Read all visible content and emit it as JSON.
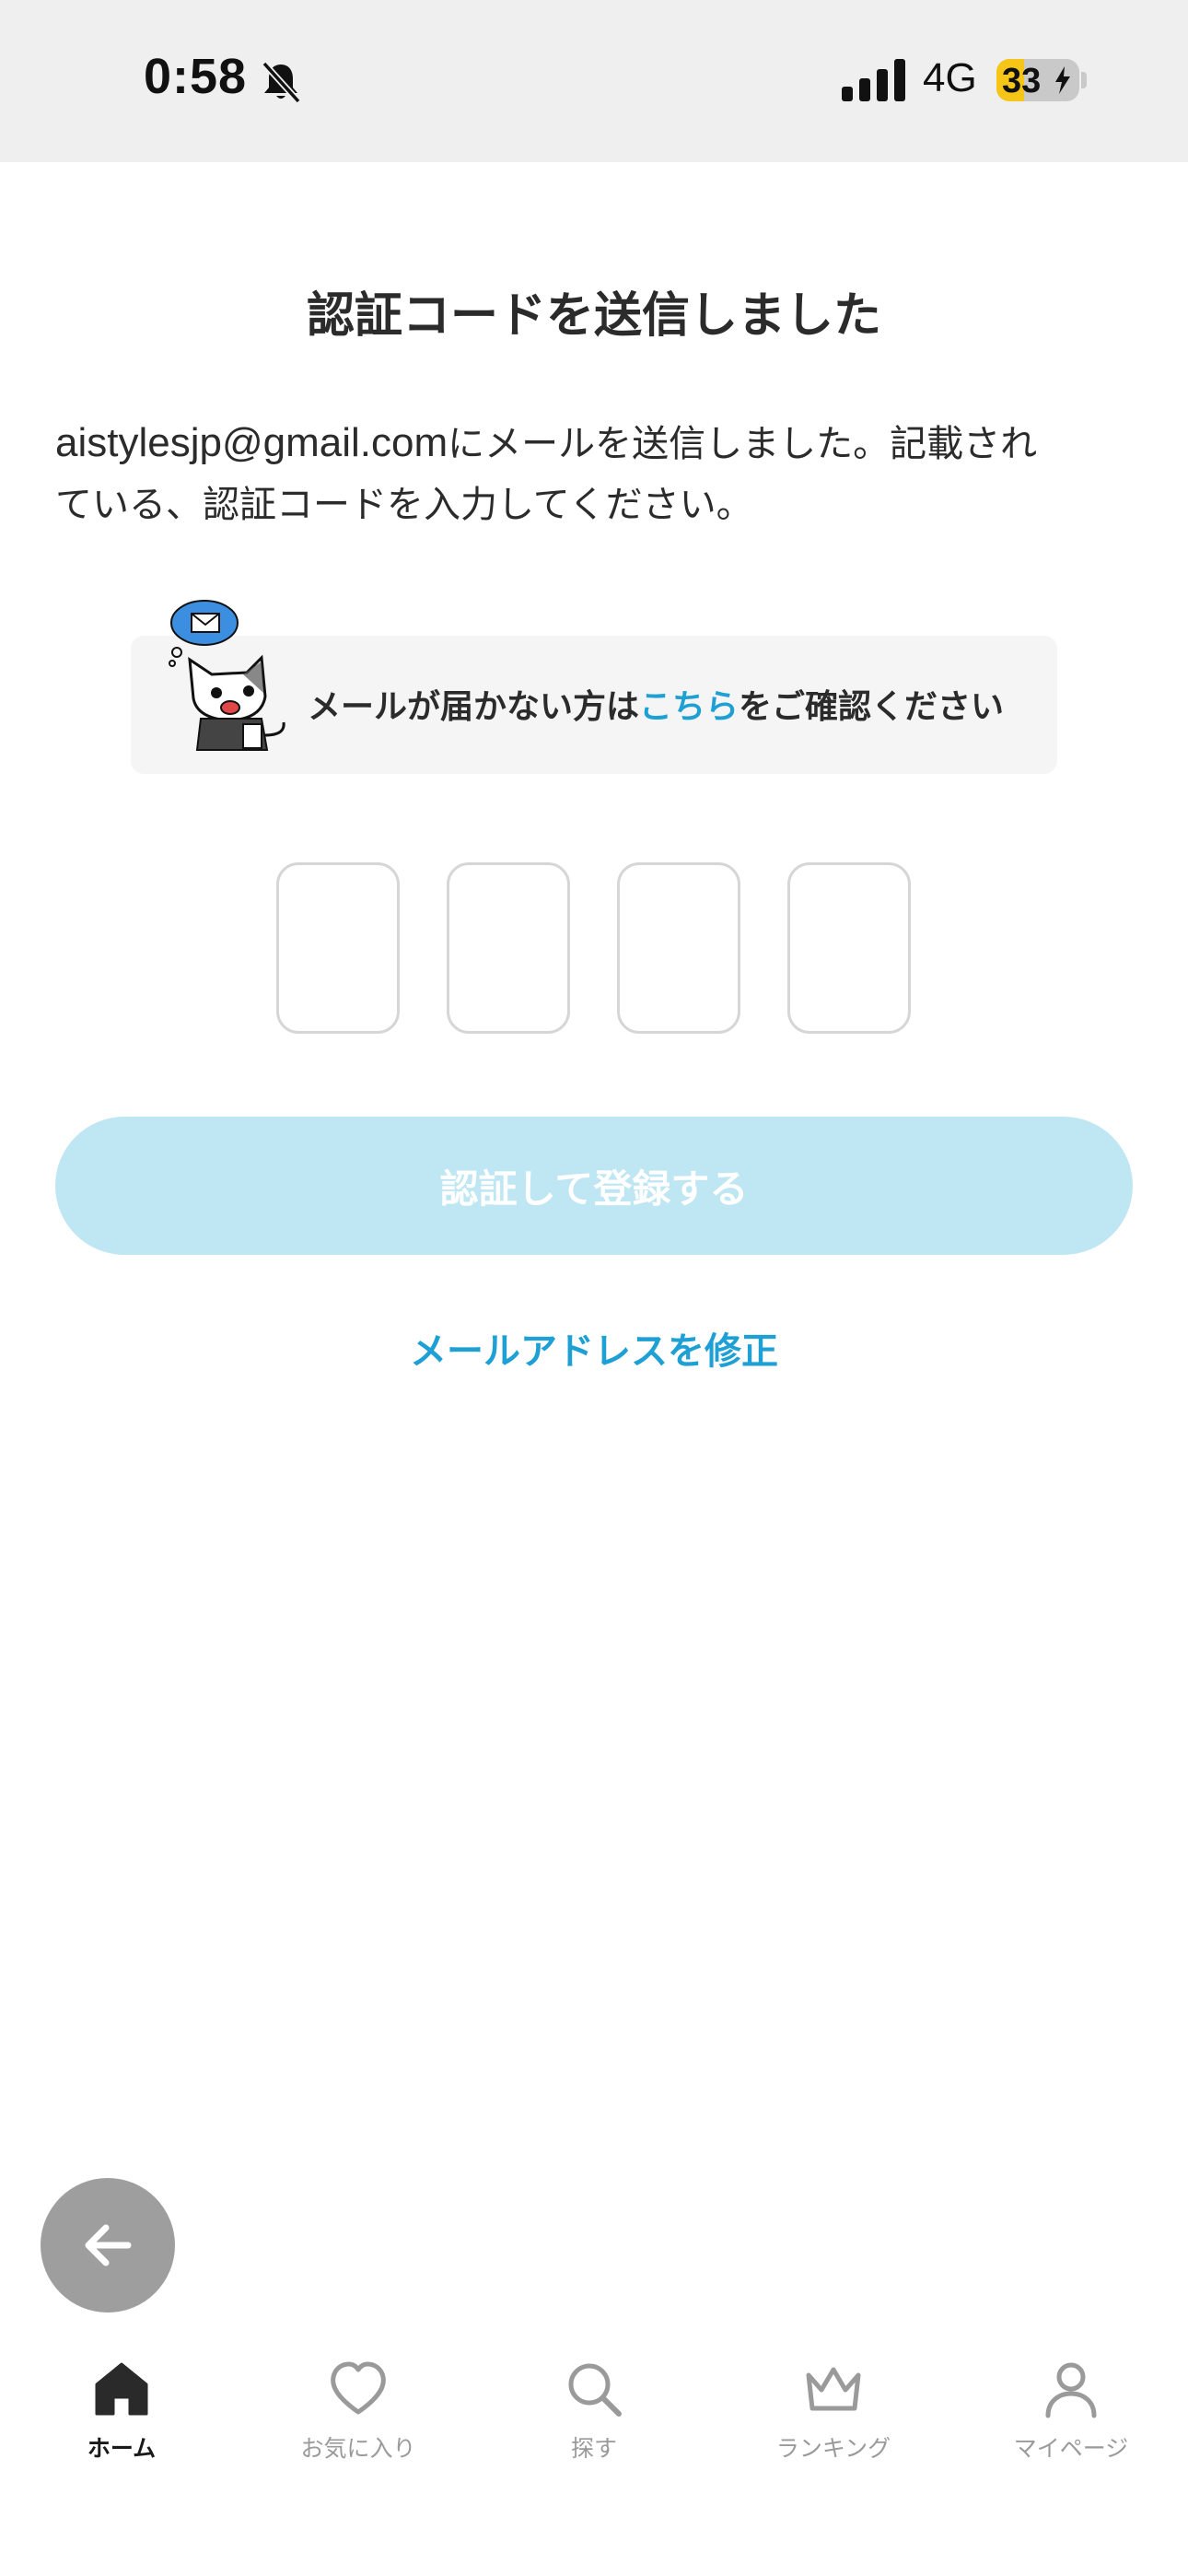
{
  "status_bar": {
    "time": "0:58",
    "network": "4G",
    "battery_level": "33",
    "battery_fraction": 0.33
  },
  "main": {
    "title": "認証コードを送信しました",
    "email": "aistylesjp@gmail.com",
    "description_line1_suffix": "にメールを送信しました。記載され",
    "description_line2": "ている、認証コードを入力してください。",
    "help_prefix": "メールが届かない方は",
    "help_link": "こちら",
    "help_suffix": "をご確認ください",
    "code_digit_count": 4,
    "verify_button_label": "認証して登録する",
    "edit_email_link": "メールアドレスを修正"
  },
  "tab_bar": {
    "items": [
      {
        "label": "ホーム",
        "icon": "home-icon",
        "active": true
      },
      {
        "label": "お気に入り",
        "icon": "heart-icon",
        "active": false
      },
      {
        "label": "探す",
        "icon": "search-icon",
        "active": false
      },
      {
        "label": "ランキング",
        "icon": "crown-icon",
        "active": false
      },
      {
        "label": "マイページ",
        "icon": "person-icon",
        "active": false
      }
    ]
  },
  "colors": {
    "accent": "#1ea0d4",
    "button_disabled": "#bfe6f3",
    "status_bar_bg": "#efefef",
    "battery_fill": "#f5c518"
  }
}
